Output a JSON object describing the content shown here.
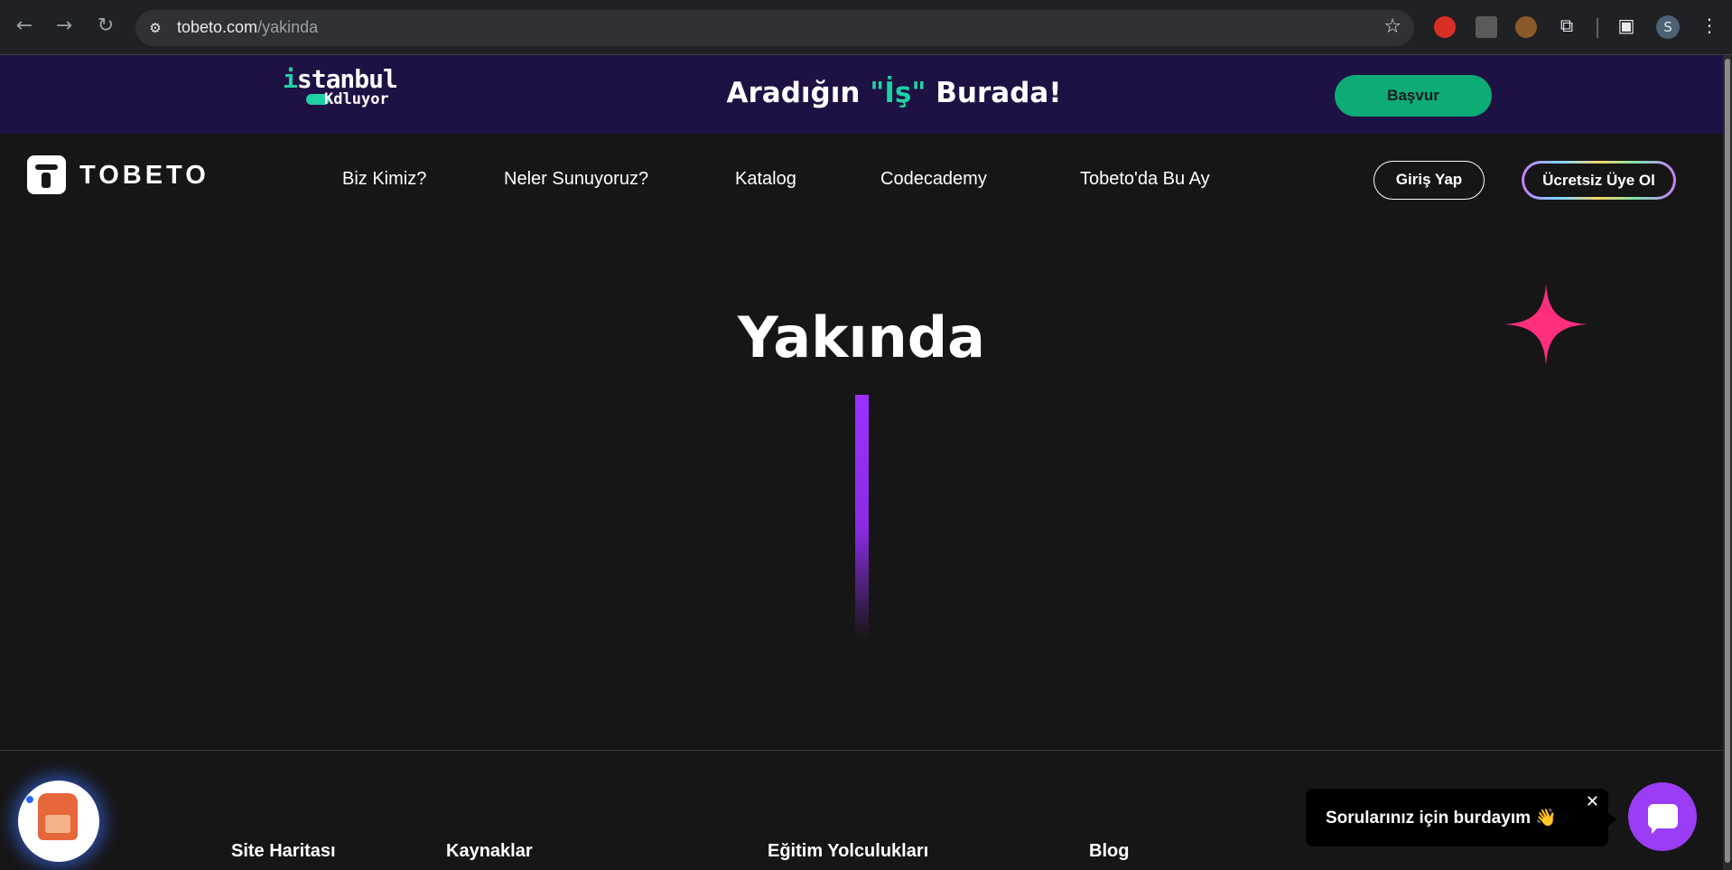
{
  "browser": {
    "back_icon": "←",
    "forward_icon": "→",
    "reload_icon": "↻",
    "site_info_icon": "⚙",
    "url_host": "tobeto.com",
    "url_path": "/yakinda",
    "star_icon": "☆",
    "profile_initial": "S"
  },
  "banner": {
    "logo_line1_dot": "i",
    "logo_line1_rest": "stanbul",
    "logo_line2_k": "K",
    "logo_line2_rest": "dluyor",
    "title_pre": "Aradığın ",
    "title_quote": "\"İş\"",
    "title_post": " Burada!",
    "apply_label": "Başvur"
  },
  "header": {
    "logo_text": "TOBETO",
    "nav": [
      {
        "label": "Biz Kimiz?"
      },
      {
        "label": "Neler Sunuyoruz?"
      },
      {
        "label": "Katalog"
      },
      {
        "label": "Codecademy"
      },
      {
        "label": "Tobeto'da Bu Ay"
      }
    ],
    "login_label": "Giriş Yap",
    "signup_label": "Ücretsiz Üye Ol"
  },
  "hero": {
    "title": "Yakında",
    "sparkle_color": "#ff2e7e",
    "line_color": "#9b30ff"
  },
  "footer": {
    "headings": [
      "Site Haritası",
      "Kaynaklar",
      "Eğitim Yolculukları",
      "Blog"
    ]
  },
  "chat": {
    "bubble_text": "Sorularınız için burdayım 👋",
    "close_icon": "✕",
    "button_color": "#9a3df5"
  },
  "colors": {
    "banner_bg": "#1e1144",
    "accent_green": "#0dab76",
    "teal": "#1fd1a3"
  }
}
